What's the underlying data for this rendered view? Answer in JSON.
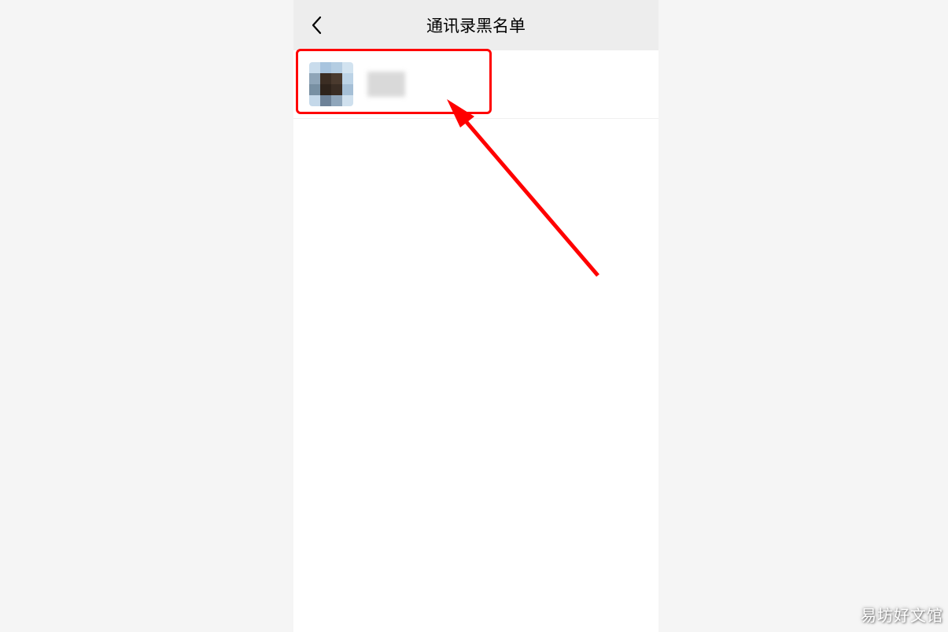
{
  "header": {
    "title": "通讯录黑名单"
  },
  "list": {
    "items": [
      {
        "name_obscured": true
      }
    ]
  },
  "watermark": "易坊好文馆"
}
